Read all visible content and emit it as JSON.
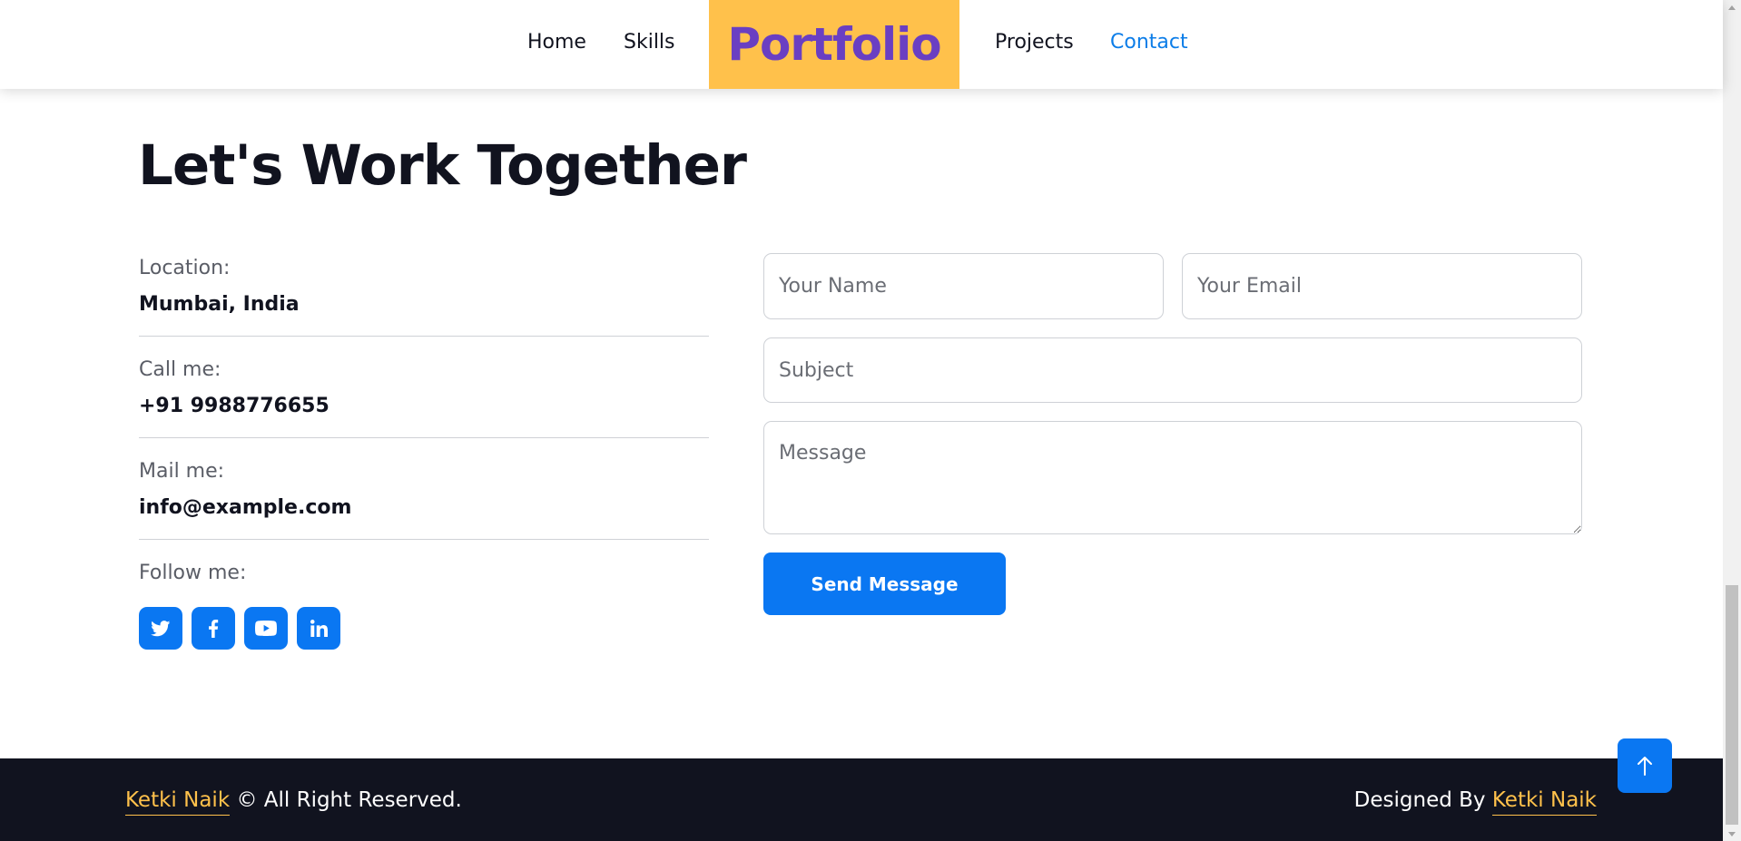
{
  "nav": {
    "links": [
      "Home",
      "Skills",
      "Projects",
      "Contact"
    ],
    "brand": "Portfolio",
    "active": "Contact"
  },
  "contact": {
    "title": "Let's Work Together",
    "location_label": "Location:",
    "location_value": "Mumbai, India",
    "call_label": "Call me:",
    "call_value": "+91 9988776655",
    "mail_label": "Mail me:",
    "mail_value": "info@example.com",
    "follow_label": "Follow me:",
    "social_icons": [
      "twitter-icon",
      "facebook-icon",
      "youtube-icon",
      "linkedin-icon"
    ]
  },
  "form": {
    "name_placeholder": "Your Name",
    "email_placeholder": "Your Email",
    "subject_placeholder": "Subject",
    "message_placeholder": "Message",
    "send_label": "Send Message"
  },
  "footer": {
    "owner_name": "Ketki Naik",
    "rights_text": "© All Right Reserved.",
    "designed_by": "Designed By",
    "designer_name": "Ketki Naik"
  },
  "colors": {
    "accent": "#0a77f2",
    "brand_bg": "#ffc14b",
    "brand_text": "#6a3fc2",
    "footer_bg": "#11131f",
    "active_link": "#0c7de8"
  }
}
